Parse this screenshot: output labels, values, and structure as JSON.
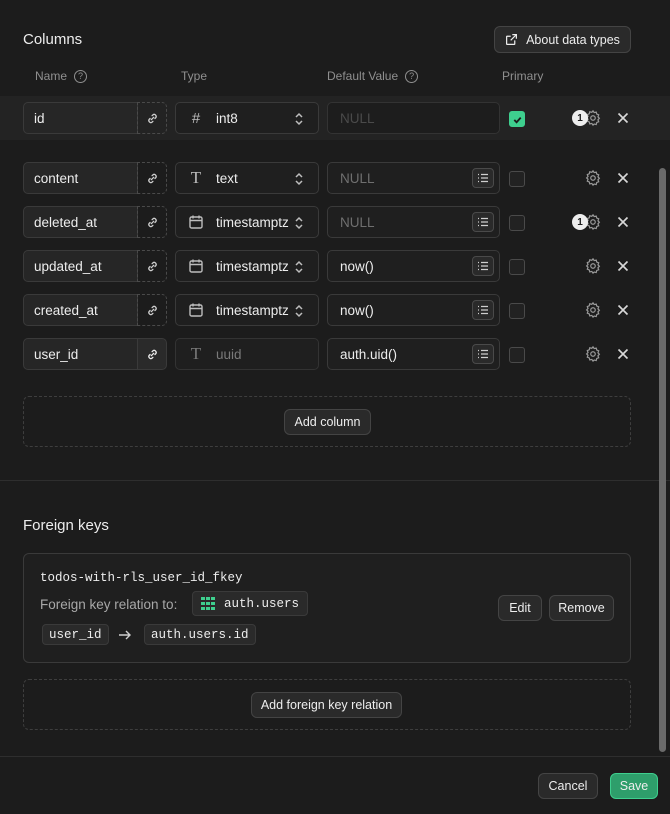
{
  "columns_section": {
    "title": "Columns",
    "about_button": "About data types",
    "headers": {
      "name": "Name",
      "type": "Type",
      "default_value": "Default Value",
      "primary": "Primary"
    },
    "rows": [
      {
        "name": "id",
        "type": "int8",
        "type_icon": "hash-icon",
        "default": "NULL",
        "default_is_placeholder": true,
        "primary": true,
        "badge": "1"
      },
      {
        "name": "content",
        "type": "text",
        "type_icon": "text-type-icon",
        "default": "NULL",
        "default_is_placeholder": true,
        "primary": false,
        "badge": ""
      },
      {
        "name": "deleted_at",
        "type": "timestamptz",
        "type_icon": "calendar-icon",
        "default": "NULL",
        "default_is_placeholder": true,
        "primary": false,
        "badge": "1"
      },
      {
        "name": "updated_at",
        "type": "timestamptz",
        "type_icon": "calendar-icon",
        "default": "now()",
        "default_is_placeholder": false,
        "primary": false,
        "badge": ""
      },
      {
        "name": "created_at",
        "type": "timestamptz",
        "type_icon": "calendar-icon",
        "default": "now()",
        "default_is_placeholder": false,
        "primary": false,
        "badge": ""
      },
      {
        "name": "user_id",
        "type": "uuid",
        "type_icon": "text-type-icon",
        "default": "auth.uid()",
        "default_is_placeholder": false,
        "primary": false,
        "badge": ""
      }
    ],
    "add_column_button": "Add column"
  },
  "foreign_keys_section": {
    "title": "Foreign keys",
    "constraint_name": "todos-with-rls_user_id_fkey",
    "relation_label": "Foreign key relation to:",
    "relation_table": "auth.users",
    "source_column": "user_id",
    "target_column": "auth.users.id",
    "edit_button": "Edit",
    "remove_button": "Remove",
    "add_fk_button": "Add foreign key relation"
  },
  "footer": {
    "cancel_button": "Cancel",
    "save_button": "Save"
  },
  "colors": {
    "accent": "#3ecf8e",
    "save_bg": "#2e9e6b",
    "background": "#1c1c1c"
  }
}
